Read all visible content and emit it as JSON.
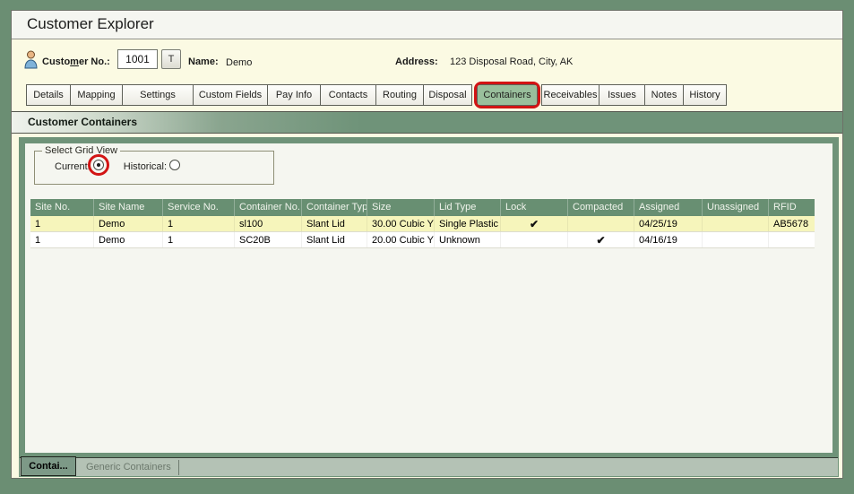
{
  "window": {
    "title": "Customer Explorer"
  },
  "customer_bar": {
    "customer_no_label": {
      "pre": "Custo",
      "underlined": "m",
      "post": "er No.:"
    },
    "customer_no_value": "1001",
    "lookup_button_label": "T",
    "name_label": "Name:",
    "name_value": "Demo",
    "address_label": "Address:",
    "address_value": "123 Disposal Road, City, AK"
  },
  "tabs": {
    "selected": "Containers",
    "items": [
      {
        "label": "Details"
      },
      {
        "label": "Mapping"
      },
      {
        "label": "Settings"
      },
      {
        "label": "Custom Fields"
      },
      {
        "label": "Pay Info"
      },
      {
        "label": "Contacts"
      },
      {
        "label": "Routing"
      },
      {
        "label": "Disposal"
      },
      {
        "label": "Containers"
      },
      {
        "label": "Receivables"
      },
      {
        "label": "Issues"
      },
      {
        "label": "Notes"
      },
      {
        "label": "History"
      }
    ]
  },
  "section": {
    "title": "Customer Containers"
  },
  "grid_view": {
    "legend": "Select Grid View",
    "current_label": "Current:",
    "historical_label": "Historical:",
    "selected": "current"
  },
  "grid": {
    "columns": [
      "Site No.",
      "Site Name",
      "Service No.",
      "Container No.",
      "Container Typ",
      "Size",
      "Lid Type",
      "Lock",
      "Compacted",
      "Assigned",
      "Unassigned",
      "RFID"
    ],
    "rows": [
      {
        "highlighted": true,
        "cells": [
          "1",
          "Demo",
          "1",
          "sl100",
          "Slant Lid",
          "30.00 Cubic Y",
          "Single Plastic",
          "✔",
          "",
          "04/25/19",
          "",
          "AB5678"
        ]
      },
      {
        "highlighted": false,
        "cells": [
          "1",
          "Demo",
          "1",
          "SC20B",
          "Slant Lid",
          "20.00 Cubic Y",
          "Unknown",
          "",
          "✔",
          "04/16/19",
          "",
          ""
        ]
      }
    ]
  },
  "bottom_tabs": {
    "active": "Contai...",
    "items": [
      {
        "label": "Contai..."
      },
      {
        "label": "Generic Containers"
      }
    ]
  },
  "annotations": {
    "color": "#d21414",
    "highlighted_tab": "Containers",
    "circled_radio": "Current"
  },
  "colors": {
    "frame_green": "#6b8e73",
    "panel_green": "#6f9379",
    "grid_header_green": "#688f72",
    "selected_tab_green": "#99bf9c",
    "highlight_row_yellow": "#f6f5bb",
    "window_cream": "#fbfae3",
    "bottom_strip_sage": "#b4c2b5"
  },
  "icons": {
    "customer": "person-silhouette"
  }
}
